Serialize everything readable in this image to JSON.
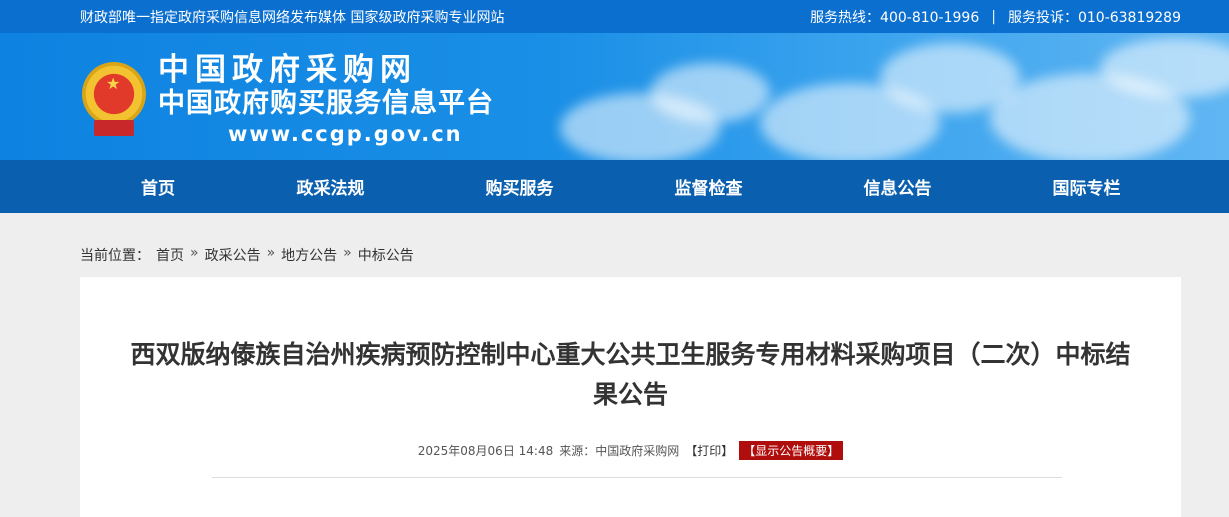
{
  "topbar": {
    "left_text": "财政部唯一指定政府采购信息网络发布媒体 国家级政府采购专业网站",
    "hotline": "服务热线：400-810-1996",
    "separator": "|",
    "complaint": "服务投诉：010-63819289"
  },
  "banner": {
    "logo_line1": "中国政府采购网",
    "logo_line2": "中国政府购买服务信息平台",
    "logo_url": "www.ccgp.gov.cn"
  },
  "nav": {
    "items": [
      {
        "label": "首页"
      },
      {
        "label": "政采法规"
      },
      {
        "label": "购买服务"
      },
      {
        "label": "监督检查"
      },
      {
        "label": "信息公告"
      },
      {
        "label": "国际专栏"
      }
    ]
  },
  "breadcrumb": {
    "prefix": "当前位置：",
    "items": [
      "首页",
      "政采公告",
      "地方公告",
      "中标公告"
    ],
    "arrow": "»"
  },
  "article": {
    "title": "西双版纳傣族自治州疾病预防控制中心重大公共卫生服务专用材料采购项目（二次）中标结果公告",
    "date": "2025年08月06日 14:48",
    "source": "来源：中国政府采购网",
    "print_label": "【打印】",
    "summary_label": "【显示公告概要】"
  },
  "colors": {
    "topbar": "#0b6fd0",
    "nav": "#0a5fae",
    "summary_badge": "#b00d0d",
    "page_bg": "#eeeeee"
  }
}
